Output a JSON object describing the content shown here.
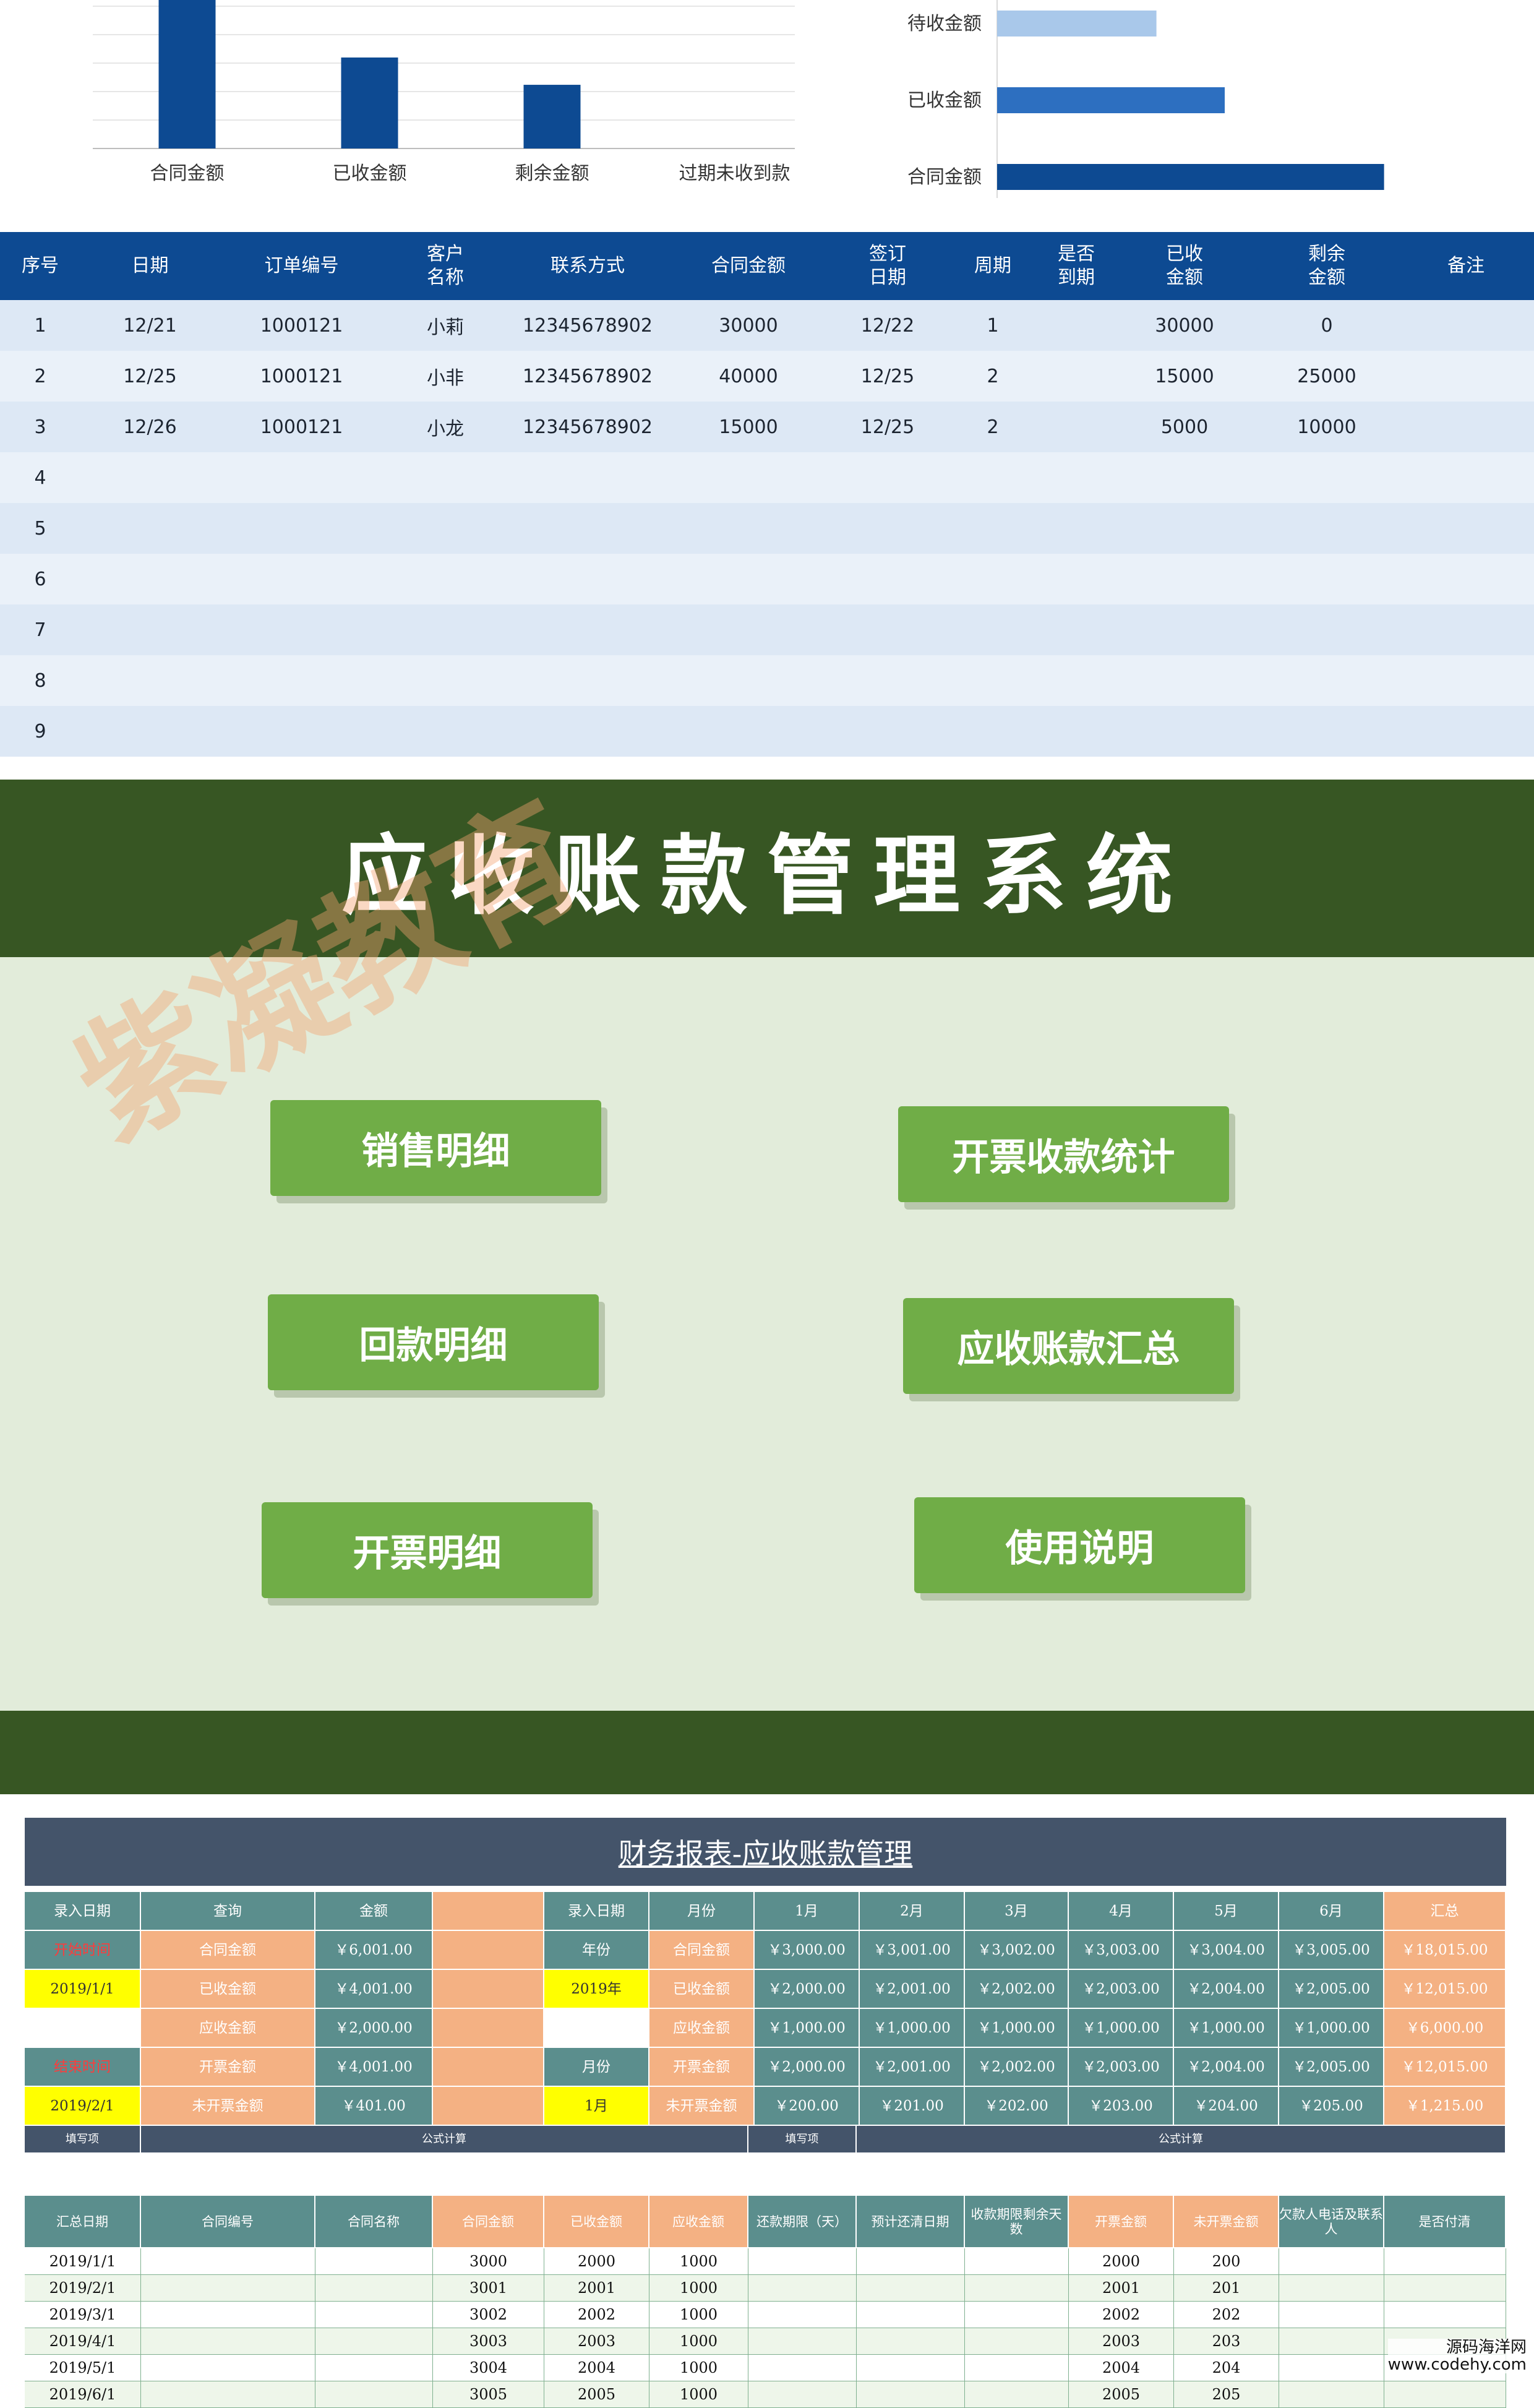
{
  "chart_data": [
    {
      "type": "bar",
      "categories": [
        "合同金额",
        "已收金额",
        "剩余金额",
        "过期未收到款"
      ],
      "values": [
        85000,
        50000,
        35000,
        0
      ],
      "ylim": [
        0,
        85000
      ]
    },
    {
      "type": "bar",
      "orientation": "horizontal",
      "categories": [
        "待收金额",
        "已收金额",
        "合同金额"
      ],
      "values": [
        35000,
        50000,
        85000
      ],
      "xlim": [
        0,
        100000
      ]
    }
  ],
  "table": {
    "headers": [
      "序号",
      "日期",
      "订单编号",
      "客户\n名称",
      "联系方式",
      "合同金额",
      "签订\n日期",
      "周期",
      "是否\n到期",
      "已收\n金额",
      "剩余\n金额",
      "备注"
    ],
    "rows": [
      [
        "1",
        "12/21",
        "1000121",
        "小莉",
        "12345678902",
        "30000",
        "12/22",
        "1",
        "",
        "30000",
        "0",
        ""
      ],
      [
        "2",
        "12/25",
        "1000121",
        "小非",
        "12345678902",
        "40000",
        "12/25",
        "2",
        "",
        "15000",
        "25000",
        ""
      ],
      [
        "3",
        "12/26",
        "1000121",
        "小龙",
        "12345678902",
        "15000",
        "12/25",
        "2",
        "",
        "5000",
        "10000",
        ""
      ],
      [
        "4",
        "",
        "",
        "",
        "",
        "",
        "",
        "",
        "",
        "",
        "",
        ""
      ],
      [
        "5",
        "",
        "",
        "",
        "",
        "",
        "",
        "",
        "",
        "",
        "",
        ""
      ],
      [
        "6",
        "",
        "",
        "",
        "",
        "",
        "",
        "",
        "",
        "",
        "",
        ""
      ],
      [
        "7",
        "",
        "",
        "",
        "",
        "",
        "",
        "",
        "",
        "",
        "",
        ""
      ],
      [
        "8",
        "",
        "",
        "",
        "",
        "",
        "",
        "",
        "",
        "",
        "",
        ""
      ],
      [
        "9",
        "",
        "",
        "",
        "",
        "",
        "",
        "",
        "",
        "",
        "",
        ""
      ]
    ]
  },
  "menu": {
    "title": "应收账款管理系统",
    "buttons": [
      "销售明细",
      "开票收款统计",
      "回款明细",
      "应收账款汇总",
      "开票明细",
      "使用说明"
    ],
    "watermark": "紫凝教育"
  },
  "finance": {
    "title": "财务报表-应收账款管理",
    "header_left": [
      "录入日期",
      "查询",
      "金额"
    ],
    "header_right": [
      "录入日期",
      "月份",
      "1月",
      "2月",
      "3月",
      "4月",
      "5月",
      "6月",
      "汇总"
    ],
    "left_rows": [
      [
        "开始时间",
        "合同金额",
        "￥6,001.00"
      ],
      [
        "2019/1/1",
        "已收金额",
        "￥4,001.00"
      ],
      [
        "",
        "应收金额",
        "￥2,000.00"
      ],
      [
        "结束时间",
        "开票金额",
        "￥4,001.00"
      ],
      [
        "2019/2/1",
        "未开票金额",
        "￥401.00"
      ]
    ],
    "right_rows": [
      [
        "年份",
        "合同金额",
        "￥3,000.00",
        "￥3,001.00",
        "￥3,002.00",
        "￥3,003.00",
        "￥3,004.00",
        "￥3,005.00",
        "￥18,015.00"
      ],
      [
        "2019年",
        "已收金额",
        "￥2,000.00",
        "￥2,001.00",
        "￥2,002.00",
        "￥2,003.00",
        "￥2,004.00",
        "￥2,005.00",
        "￥12,015.00"
      ],
      [
        "",
        "应收金额",
        "￥1,000.00",
        "￥1,000.00",
        "￥1,000.00",
        "￥1,000.00",
        "￥1,000.00",
        "￥1,000.00",
        "￥6,000.00"
      ],
      [
        "月份",
        "开票金额",
        "￥2,000.00",
        "￥2,001.00",
        "￥2,002.00",
        "￥2,003.00",
        "￥2,004.00",
        "￥2,005.00",
        "￥12,015.00"
      ],
      [
        "1月",
        "未开票金额",
        "￥200.00",
        "￥201.00",
        "￥202.00",
        "￥203.00",
        "￥204.00",
        "￥205.00",
        "￥1,215.00"
      ]
    ],
    "band": [
      "填写项",
      "公式计算",
      "填写项",
      "公式计算"
    ],
    "detail_headers": [
      "汇总日期",
      "合同编号",
      "合同名称",
      "合同金额",
      "已收金额",
      "应收金额",
      "还款期限（天）",
      "预计还清日期",
      "收款期限剩余天数",
      "开票金额",
      "未开票金额",
      "欠款人电话及联系人",
      "是否付清"
    ],
    "detail_rows": [
      [
        "2019/1/1",
        "",
        "",
        "3000",
        "2000",
        "1000",
        "",
        "",
        "",
        "2000",
        "200",
        "",
        ""
      ],
      [
        "2019/2/1",
        "",
        "",
        "3001",
        "2001",
        "1000",
        "",
        "",
        "",
        "2001",
        "201",
        "",
        ""
      ],
      [
        "2019/3/1",
        "",
        "",
        "3002",
        "2002",
        "1000",
        "",
        "",
        "",
        "2002",
        "202",
        "",
        ""
      ],
      [
        "2019/4/1",
        "",
        "",
        "3003",
        "2003",
        "1000",
        "",
        "",
        "",
        "2003",
        "203",
        "",
        ""
      ],
      [
        "2019/5/1",
        "",
        "",
        "3004",
        "2004",
        "1000",
        "",
        "",
        "",
        "2004",
        "204",
        "",
        ""
      ],
      [
        "2019/6/1",
        "",
        "",
        "3005",
        "2005",
        "1000",
        "",
        "",
        "",
        "2005",
        "205",
        "",
        ""
      ]
    ],
    "credit": [
      "源码海洋网",
      "www.codehy.com"
    ]
  }
}
